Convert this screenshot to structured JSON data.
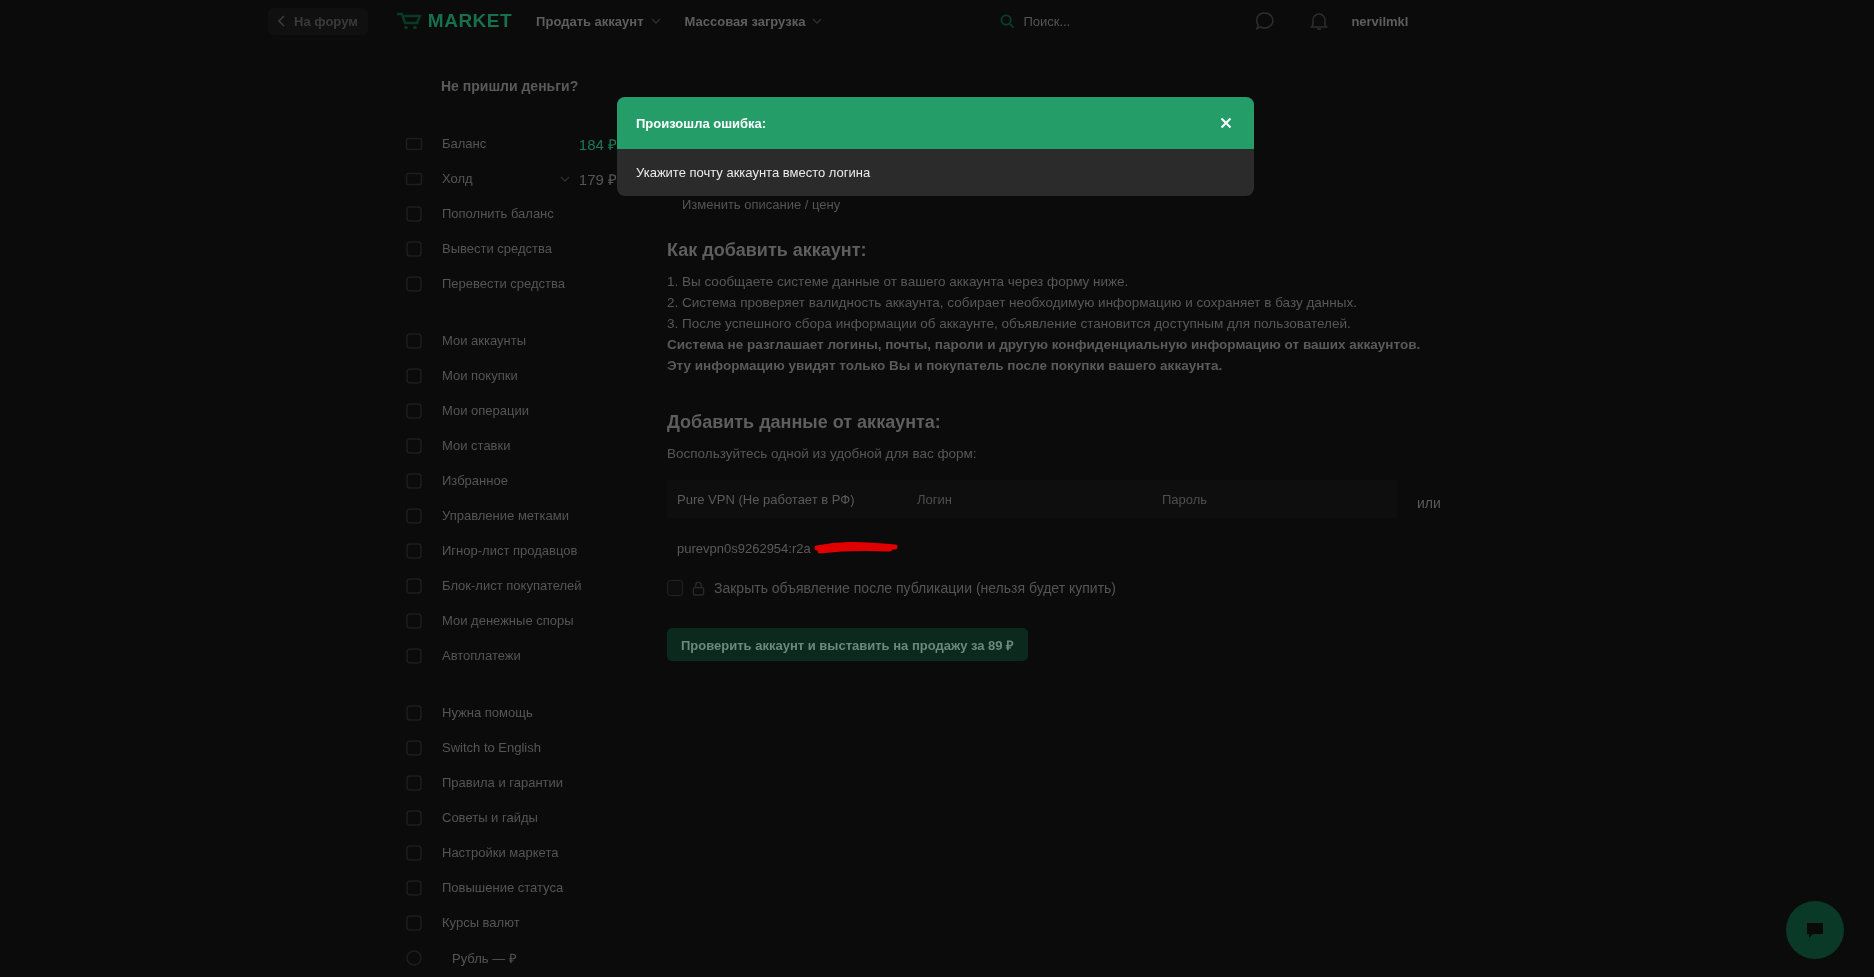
{
  "top_bar": {
    "back_link": "На форум",
    "logo": "MARKET",
    "nav": [
      {
        "label": "Продать аккаунт",
        "has_caret": true
      },
      {
        "label": "Массовая загрузка",
        "has_caret": true
      }
    ],
    "search": {
      "placeholder": "Поиск..."
    },
    "username": "nervilmkl"
  },
  "sidebar": {
    "question": "Не пришли деньги?",
    "balances": [
      {
        "label": "Баланс",
        "value": "184 ₽",
        "kind": "balance"
      },
      {
        "label": "Холд",
        "value": "179 ₽",
        "kind": "hold"
      }
    ],
    "groups": [
      [
        {
          "label": "Пополнить баланс",
          "kind": "link"
        },
        {
          "label": "Вывести средства",
          "kind": "link"
        },
        {
          "label": "Перевести средства",
          "kind": "link"
        }
      ],
      [
        {
          "label": "Мои аккаунты",
          "kind": "link"
        },
        {
          "label": "Мои покупки",
          "kind": "link"
        },
        {
          "label": "Мои операции",
          "kind": "link"
        },
        {
          "label": "Мои ставки",
          "kind": "link"
        },
        {
          "label": "Избранное",
          "kind": "link"
        },
        {
          "label": "Управление метками",
          "kind": "link"
        },
        {
          "label": "Игнор-лист продавцов",
          "kind": "link"
        },
        {
          "label": "Блок-лист покупателей",
          "kind": "link"
        },
        {
          "label": "Мои денежные споры",
          "kind": "link"
        },
        {
          "label": "Автоплатежи",
          "kind": "link"
        }
      ],
      [
        {
          "label": "Нужна помощь",
          "kind": "link"
        },
        {
          "label": "Switch to English",
          "kind": "link"
        },
        {
          "label": "Правила и гарантии",
          "kind": "link"
        },
        {
          "label": "Советы и гайды",
          "kind": "link"
        },
        {
          "label": "Настройки маркета",
          "kind": "link"
        },
        {
          "label": "Повышение статуса",
          "kind": "link"
        },
        {
          "label": "Курсы валют",
          "kind": "link"
        },
        {
          "label": "Рубль — ₽",
          "kind": "currency"
        }
      ]
    ]
  },
  "main": {
    "edit_link": "Изменить описание / цену",
    "how_to": {
      "title": "Как добавить аккаунт:",
      "steps": [
        "1. Вы сообщаете системе данные от вашего аккаунта через форму ниже.",
        "2. Система проверяет валидность аккаунта, собирает необходимую информацию и сохраняет в базу данных.",
        "3. После успешного сбора информации об аккаунте, объявление становится доступным для пользователей."
      ],
      "notice": "Система не разглашает логины, почты, пароли и другую конфиденциальную информацию от ваших аккаунтов. Эту информацию увидят только Вы и покупатель после покупки вашего аккаунта."
    },
    "add_data": {
      "title": "Добавить данные от аккаунта:",
      "subtitle": "Воспользуйтесь одной из удобной для вас форм:",
      "service": "Pure VPN (Не работает в РФ)",
      "login": {
        "placeholder": "Логин"
      },
      "password": {
        "placeholder": "Пароль"
      },
      "or_label": "или",
      "credentials": {
        "value": "purevpn0s9262954:r2a",
        "redacted": true
      },
      "close_option": {
        "label": "Закрыть объявление после публикации (нельзя будет купить)",
        "checked": false
      },
      "submit": "Проверить аккаунт и выставить на продажу за 89 ₽"
    }
  },
  "modal": {
    "title": "Произошла ошибка:",
    "message": "Укажите почту аккаунта вместо логина"
  }
}
